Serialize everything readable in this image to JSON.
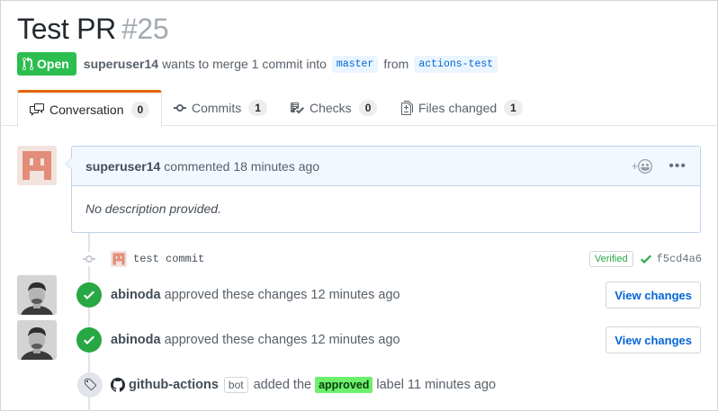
{
  "pr": {
    "title": "Test PR",
    "number": "#25",
    "state_label": "Open",
    "author": "superuser14",
    "merge_text": "wants to merge 1 commit into",
    "base_branch": "master",
    "from_text": "from",
    "head_branch": "actions-test"
  },
  "tabs": [
    {
      "label": "Conversation",
      "count": "0",
      "icon": "comment-discussion-icon"
    },
    {
      "label": "Commits",
      "count": "1",
      "icon": "git-commit-icon"
    },
    {
      "label": "Checks",
      "count": "0",
      "icon": "checklist-icon"
    },
    {
      "label": "Files changed",
      "count": "1",
      "icon": "diff-icon"
    }
  ],
  "comment": {
    "author": "superuser14",
    "meta": "commented 18 minutes ago",
    "reaction_symbol": "+",
    "body": "No description provided."
  },
  "commit": {
    "message": "test commit",
    "verified_label": "Verified",
    "sha": "f5cd4a6"
  },
  "reviews": [
    {
      "author": "abinoda",
      "text": "approved these changes 12 minutes ago",
      "button": "View changes"
    },
    {
      "author": "abinoda",
      "text": "approved these changes 12 minutes ago",
      "button": "View changes"
    }
  ],
  "label_event": {
    "author": "github-actions",
    "bot_badge": "bot",
    "added_text": "added the",
    "label_name": "approved",
    "label_color": "#6ef06e",
    "suffix": "label 11 minutes ago"
  },
  "colors": {
    "open_green": "#2cbe4e",
    "link_blue": "#0366d6",
    "tab_accent": "#e36209"
  }
}
